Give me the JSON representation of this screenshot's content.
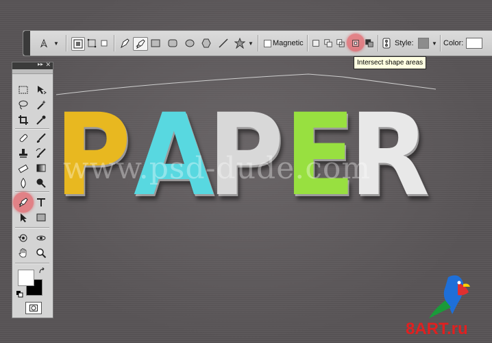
{
  "options_bar": {
    "magnetic_label": "Magnetic",
    "style_label": "Style:",
    "color_label": "Color:",
    "style_value_color": "#8c8c8c",
    "color_value": "#ffffff",
    "highlight_color": "#e83c46"
  },
  "tooltip": {
    "text": "Intersect shape areas"
  },
  "artwork": {
    "letters": [
      {
        "char": "P",
        "color": "#e8b820"
      },
      {
        "char": "A",
        "color": "#58d8e0"
      },
      {
        "char": "P",
        "color": "#d8d8d8"
      },
      {
        "char": "E",
        "color": "#98e040"
      },
      {
        "char": "R",
        "color": "#e8e8e8"
      }
    ],
    "watermark": "www.psd-dude.com"
  },
  "tools_panel": {
    "header_collapse": "▸▸",
    "header_close": "✕",
    "foreground_color": "#ffffff",
    "background_color": "#000000"
  },
  "logo": {
    "text": "8ART.ru",
    "color": "#e02020"
  }
}
